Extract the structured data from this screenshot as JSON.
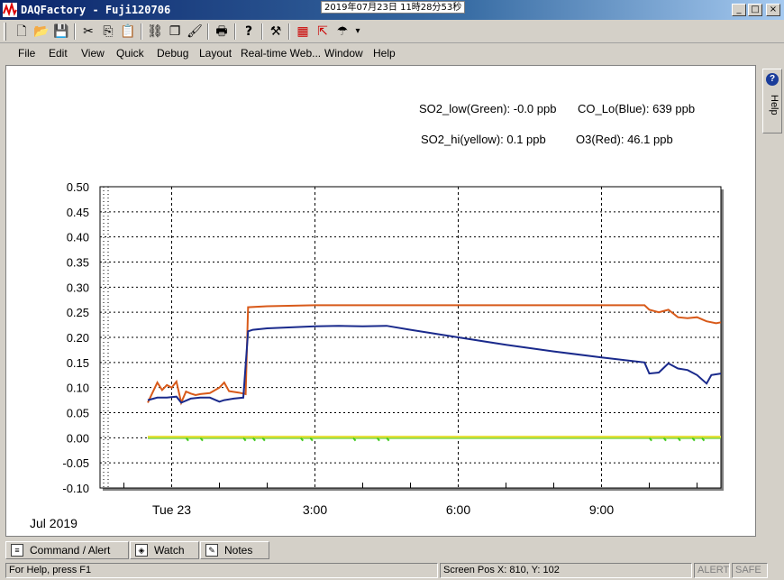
{
  "window": {
    "title": "DAQFactory - Fuji120706",
    "clock": "2019年07月23日 11時28分53秒",
    "buttons": [
      "_",
      "□",
      "×"
    ]
  },
  "toolbar": {
    "icons": [
      "new-icon",
      "open-icon",
      "save-icon",
      "cut-icon",
      "copy-icon",
      "paste-icon",
      "link-icon",
      "duplicate-icon",
      "brush-icon",
      "print-icon",
      "help-icon",
      "tools-icon",
      "table-icon",
      "export-icon",
      "web-icon"
    ],
    "more": "▾"
  },
  "menu": [
    "File",
    "Edit",
    "View",
    "Quick",
    "Debug",
    "Layout",
    "Real-time Web...",
    "Window",
    "Help"
  ],
  "legend": {
    "so2_low": "SO2_low(Green): -0.0 ppb",
    "co_lo": "CO_Lo(Blue): 639 ppb",
    "so2_hi": "SO2_hi(yellow): 0.1 ppb",
    "o3": "O3(Red): 46.1 ppb"
  },
  "chart_data": {
    "type": "line",
    "ylim": [
      -0.1,
      0.5
    ],
    "yticks": [
      "0.50",
      "0.45",
      "0.40",
      "0.35",
      "0.30",
      "0.25",
      "0.20",
      "0.15",
      "0.10",
      "0.05",
      "0.00",
      "-0.05",
      "-0.10"
    ],
    "xlim": [
      -1.5,
      11.5
    ],
    "xticks": [
      {
        "x": 0,
        "label": "Tue 23"
      },
      {
        "x": 3,
        "label": "3:00"
      },
      {
        "x": 6,
        "label": "6:00"
      },
      {
        "x": 9,
        "label": "9:00"
      }
    ],
    "date_label": "Jul 2019",
    "series": [
      {
        "color": "#d85a1a",
        "x": [
          -0.5,
          -0.4,
          -0.3,
          -0.2,
          -0.1,
          0.0,
          0.1,
          0.2,
          0.3,
          0.4,
          0.5,
          0.6,
          0.8,
          1.0,
          1.1,
          1.2,
          1.4,
          1.55,
          1.6,
          2.0,
          3.0,
          4.0,
          5.0,
          6.0,
          7.0,
          8.0,
          9.0,
          9.9,
          10.0,
          10.2,
          10.4,
          10.6,
          10.8,
          11.0,
          11.2,
          11.4,
          11.5
        ],
        "y": [
          0.07,
          0.09,
          0.11,
          0.095,
          0.105,
          0.1,
          0.112,
          0.07,
          0.092,
          0.088,
          0.085,
          0.087,
          0.089,
          0.1,
          0.11,
          0.093,
          0.09,
          0.087,
          0.26,
          0.262,
          0.264,
          0.264,
          0.264,
          0.264,
          0.264,
          0.264,
          0.264,
          0.264,
          0.255,
          0.25,
          0.255,
          0.24,
          0.238,
          0.24,
          0.232,
          0.228,
          0.23
        ]
      },
      {
        "color": "#1a2a8c",
        "x": [
          -0.5,
          -0.3,
          -0.1,
          0.1,
          0.2,
          0.4,
          0.6,
          0.8,
          1.0,
          1.1,
          1.3,
          1.5,
          1.6,
          1.7,
          2.0,
          3.0,
          3.5,
          4.0,
          4.5,
          5.0,
          6.0,
          7.0,
          8.0,
          9.0,
          9.9,
          10.0,
          10.2,
          10.4,
          10.6,
          10.8,
          11.0,
          11.2,
          11.3,
          11.5
        ],
        "y": [
          0.075,
          0.08,
          0.08,
          0.082,
          0.07,
          0.078,
          0.08,
          0.08,
          0.072,
          0.075,
          0.078,
          0.08,
          0.212,
          0.215,
          0.218,
          0.222,
          0.223,
          0.222,
          0.223,
          0.215,
          0.2,
          0.185,
          0.172,
          0.16,
          0.15,
          0.128,
          0.13,
          0.148,
          0.138,
          0.135,
          0.125,
          0.108,
          0.125,
          0.128
        ]
      },
      {
        "color": "#44cc22",
        "x": [
          -0.5,
          11.5
        ],
        "y": [
          0.0,
          0.0
        ]
      },
      {
        "color": "#e8e040",
        "x": [
          -0.5,
          11.5
        ],
        "y": [
          0.002,
          0.002
        ]
      }
    ]
  },
  "help_tab": {
    "label": "Help"
  },
  "tabs": [
    {
      "label": "Command / Alert",
      "icon": "command-icon"
    },
    {
      "label": "Watch",
      "icon": "watch-icon"
    },
    {
      "label": "Notes",
      "icon": "notes-icon"
    }
  ],
  "status": {
    "help": "For Help, press F1",
    "pos": "Screen Pos X: 810, Y: 102",
    "alert": "ALERT",
    "safe": "SAFE"
  }
}
